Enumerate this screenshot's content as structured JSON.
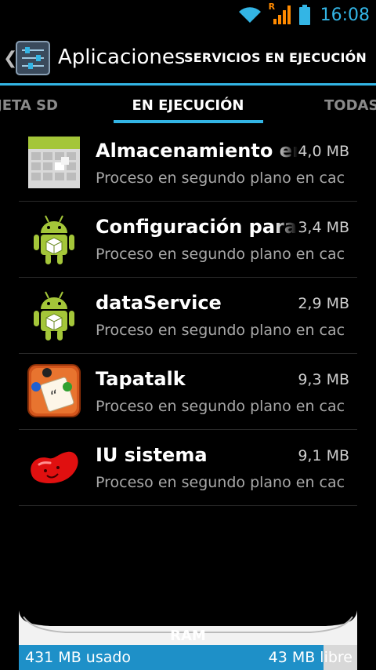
{
  "status_bar": {
    "time": "16:08",
    "roaming_indicator": "R",
    "icons": [
      "wifi-icon",
      "signal-icon",
      "battery-icon"
    ],
    "accent": "#33b5e5"
  },
  "action_bar": {
    "title": "Aplicaciones",
    "action_label": "SERVICIOS EN EJECUCIÓN",
    "icon": "settings-sliders-icon"
  },
  "tabs": [
    {
      "label": "JETA SD",
      "selected": false
    },
    {
      "label": "EN EJECUCIÓN",
      "selected": true
    },
    {
      "label": "TODAS",
      "selected": false
    }
  ],
  "processes": [
    {
      "name": "Almacenamiento en c",
      "size": "4,0 MB",
      "status": "Proceso en segundo plano en cac",
      "icon": "calendar-storage-icon"
    },
    {
      "name": "Configuración para p",
      "size": "3,4 MB",
      "status": "Proceso en segundo plano en cac",
      "icon": "android-robot-icon"
    },
    {
      "name": "dataService",
      "size": "2,9 MB",
      "status": "Proceso en segundo plano en cac",
      "icon": "android-robot-icon"
    },
    {
      "name": "Tapatalk",
      "size": "9,3 MB",
      "status": "Proceso en segundo plano en cac",
      "icon": "tapatalk-icon"
    },
    {
      "name": "IU sistema",
      "size": "9,1 MB",
      "status": "Proceso en segundo plano en cac",
      "icon": "jelly-bean-icon"
    }
  ],
  "ram": {
    "label": "RAM",
    "used": "431 MB usado",
    "free": "43 MB libre",
    "used_fraction": 0.9
  }
}
